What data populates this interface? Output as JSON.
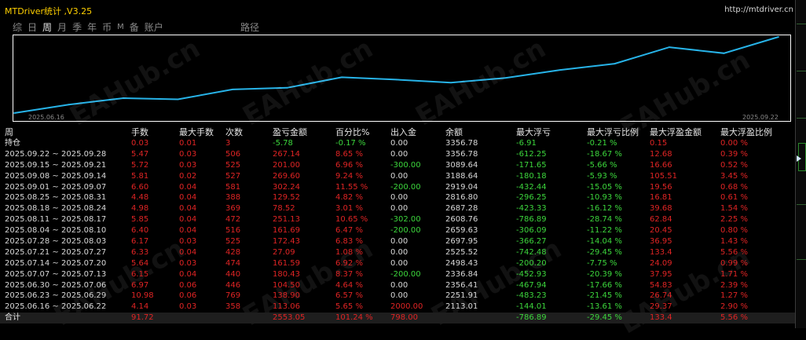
{
  "window": {
    "title": "MTDriver统计 ,V3.25",
    "link": "http://mtdriver.cn"
  },
  "tabs": [
    "综",
    "日",
    "周",
    "月",
    "季",
    "年",
    "币",
    "M",
    "备",
    "账户"
  ],
  "active_tab": "周",
  "path_tab": "路径",
  "watermark": "EAHub.cn",
  "chart_data": {
    "type": "line",
    "x_start_label": "2025.06.16",
    "x_end_label": "2025.09.22",
    "line_color": "#27b3e8",
    "x": [
      "2025.06.16",
      "2025.06.23",
      "2025.06.30",
      "2025.07.07",
      "2025.07.14",
      "2025.07.21",
      "2025.07.28",
      "2025.08.04",
      "2025.08.11",
      "2025.08.18",
      "2025.08.25",
      "2025.09.01",
      "2025.09.08",
      "2025.09.15",
      "2025.09.22"
    ],
    "y": [
      2113.01,
      2251.91,
      2356.41,
      2336.84,
      2498.43,
      2525.52,
      2697.95,
      2659.63,
      2608.76,
      2687.28,
      2816.8,
      2919.04,
      3188.64,
      3089.64,
      3356.78
    ]
  },
  "table": {
    "headers": [
      "周",
      "手数",
      "最大手数",
      "次数",
      "盈亏金额",
      "百分比%",
      "出入金",
      "余额",
      "最大浮亏",
      "最大浮亏比例",
      "最大浮盈金额",
      "最大浮盈比例"
    ],
    "holding": [
      "持仓",
      "0.03",
      "0.01",
      "3",
      "-5.78",
      "-0.17 %",
      "0.00",
      "3356.78",
      "-6.91",
      "-0.21 %",
      "0.15",
      "0.00 %"
    ],
    "rows": [
      [
        "2025.09.22 ~ 2025.09.28",
        "5.47",
        "0.03",
        "506",
        "267.14",
        "8.65 %",
        "0.00",
        "3356.78",
        "-612.25",
        "-18.67 %",
        "12.68",
        "0.39 %"
      ],
      [
        "2025.09.15 ~ 2025.09.21",
        "5.72",
        "0.03",
        "525",
        "201.00",
        "6.96 %",
        "-300.00",
        "3089.64",
        "-171.65",
        "-5.66 %",
        "16.66",
        "0.52 %"
      ],
      [
        "2025.09.08 ~ 2025.09.14",
        "5.81",
        "0.02",
        "527",
        "269.60",
        "9.24 %",
        "0.00",
        "3188.64",
        "-180.18",
        "-5.93 %",
        "105.51",
        "3.45 %"
      ],
      [
        "2025.09.01 ~ 2025.09.07",
        "6.60",
        "0.04",
        "581",
        "302.24",
        "11.55 %",
        "-200.00",
        "2919.04",
        "-432.44",
        "-15.05 %",
        "19.56",
        "0.68 %"
      ],
      [
        "2025.08.25 ~ 2025.08.31",
        "4.48",
        "0.04",
        "388",
        "129.52",
        "4.82 %",
        "0.00",
        "2816.80",
        "-296.25",
        "-10.93 %",
        "16.81",
        "0.61 %"
      ],
      [
        "2025.08.18 ~ 2025.08.24",
        "4.98",
        "0.04",
        "369",
        "78.52",
        "3.01 %",
        "0.00",
        "2687.28",
        "-423.33",
        "-16.12 %",
        "39.68",
        "1.54 %"
      ],
      [
        "2025.08.11 ~ 2025.08.17",
        "5.85",
        "0.04",
        "472",
        "251.13",
        "10.65 %",
        "-302.00",
        "2608.76",
        "-786.89",
        "-28.74 %",
        "62.84",
        "2.25 %"
      ],
      [
        "2025.08.04 ~ 2025.08.10",
        "6.40",
        "0.04",
        "516",
        "161.69",
        "6.47 %",
        "-200.00",
        "2659.63",
        "-306.09",
        "-11.22 %",
        "20.45",
        "0.80 %"
      ],
      [
        "2025.07.28 ~ 2025.08.03",
        "6.17",
        "0.03",
        "525",
        "172.43",
        "6.83 %",
        "0.00",
        "2697.95",
        "-366.27",
        "-14.04 %",
        "36.95",
        "1.43 %"
      ],
      [
        "2025.07.21 ~ 2025.07.27",
        "6.33",
        "0.04",
        "428",
        "27.09",
        "1.08 %",
        "0.00",
        "2525.52",
        "-742.48",
        "-29.45 %",
        "133.4",
        "5.56 %"
      ],
      [
        "2025.07.14 ~ 2025.07.20",
        "5.64",
        "0.03",
        "474",
        "161.59",
        "6.92 %",
        "0.00",
        "2498.43",
        "-200.20",
        "-7.75 %",
        "24.09",
        "0.99 %"
      ],
      [
        "2025.07.07 ~ 2025.07.13",
        "6.15",
        "0.04",
        "440",
        "180.43",
        "8.37 %",
        "-200.00",
        "2336.84",
        "-452.93",
        "-20.39 %",
        "37.95",
        "1.71 %"
      ],
      [
        "2025.06.30 ~ 2025.07.06",
        "6.97",
        "0.06",
        "446",
        "104.50",
        "4.64 %",
        "0.00",
        "2356.41",
        "-467.94",
        "-17.66 %",
        "54.83",
        "2.39 %"
      ],
      [
        "2025.06.23 ~ 2025.06.29",
        "10.98",
        "0.06",
        "769",
        "138.90",
        "6.57 %",
        "0.00",
        "2251.91",
        "-483.23",
        "-21.45 %",
        "26.74",
        "1.27 %"
      ],
      [
        "2025.06.16 ~ 2025.06.22",
        "4.14",
        "0.03",
        "358",
        "113.06",
        "5.65 %",
        "2000.00",
        "2113.01",
        "-144.01",
        "-13.61 %",
        "29.37",
        "2.90 %"
      ]
    ],
    "total": [
      "合计",
      "91.72",
      "",
      "",
      "2553.05",
      "101.24 %",
      "798.00",
      "",
      "-786.89",
      "-29.45 %",
      "133.4",
      "5.56 %"
    ]
  },
  "colors": {
    "accent_title": "#ffd000",
    "positive": "#3cd63c",
    "negative": "#e02424",
    "chart_line": "#27b3e8"
  }
}
